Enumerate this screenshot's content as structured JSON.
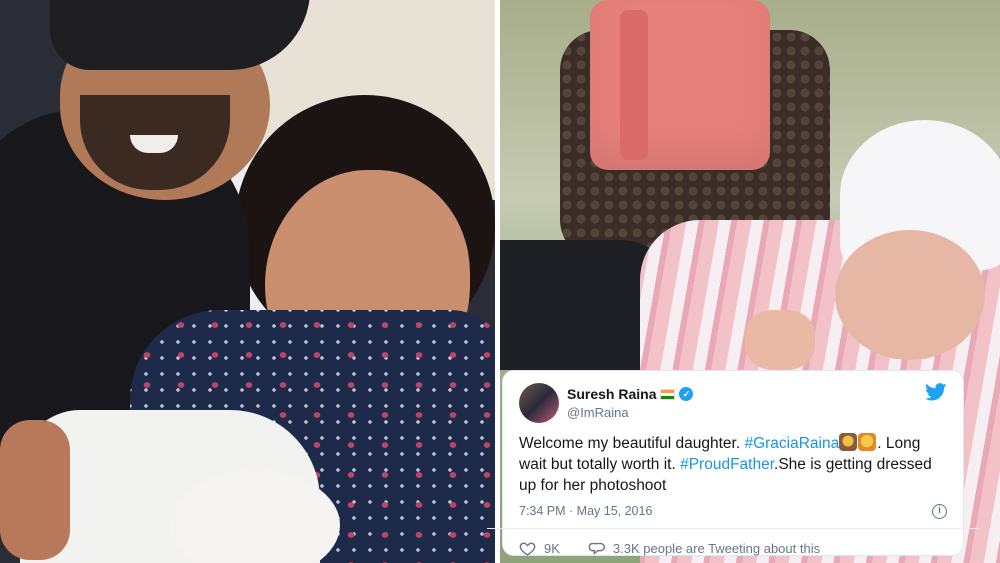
{
  "tweet": {
    "author_name": "Suresh Raina",
    "handle": "@ImRaina",
    "text_parts": [
      {
        "text": "Welcome my beautiful daughter. ",
        "type": "text"
      },
      {
        "text": "#GraciaRaina",
        "type": "hashtag"
      },
      {
        "text": ". Long wait but totally worth it. ",
        "type": "text"
      },
      {
        "text": "#ProudFather",
        "type": "hashtag"
      },
      {
        "text": ".She is getting dressed up for her photoshoot",
        "type": "text"
      }
    ],
    "timestamp": "7:34 PM · May 15, 2016",
    "likes": "9K",
    "replies_text": "3.3K people are Tweeting about this",
    "info_glyph": "i"
  },
  "colors": {
    "hashtag": "#1b95e0",
    "twitter_blue": "#1da1f2",
    "text": "#14171a",
    "muted": "#657786"
  },
  "icons": {
    "flag": "india-flag-icon",
    "verified": "verified-badge-icon",
    "brand": "twitter-bird-icon",
    "like": "heart-icon",
    "reply": "speech-bubble-icon",
    "info": "info-icon"
  }
}
